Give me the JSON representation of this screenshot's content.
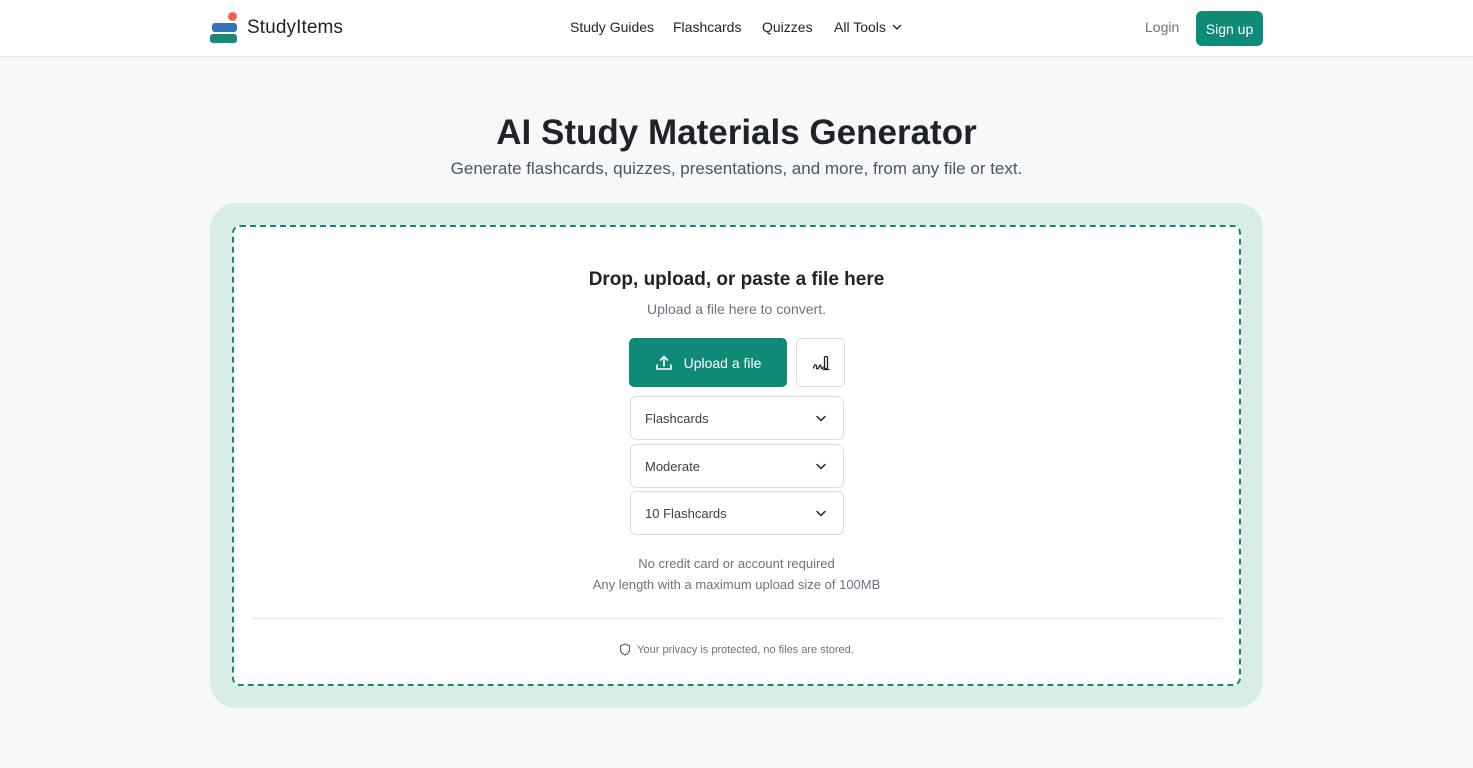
{
  "header": {
    "brand": "StudyItems",
    "nav": {
      "study_guides": "Study Guides",
      "flashcards": "Flashcards",
      "quizzes": "Quizzes",
      "all_tools": "All Tools"
    },
    "login": "Login",
    "signup": "Sign up"
  },
  "hero": {
    "title": "AI Study Materials Generator",
    "subtitle": "Generate flashcards, quizzes, presentations, and more, from any file or text."
  },
  "upload": {
    "title": "Drop, upload, or paste a file here",
    "subtitle": "Upload a file here to convert.",
    "upload_button": "Upload a file",
    "write_icon": "handwriting-icon",
    "type_select": "Flashcards",
    "difficulty_select": "Moderate",
    "count_select": "10 Flashcards",
    "note_account": "No credit card or account required",
    "note_size": "Any length with a maximum upload size of 100MB",
    "privacy": "Your privacy is protected, no files are stored."
  },
  "colors": {
    "accent": "#0f8a77",
    "card_bg": "#d8ede8",
    "page_bg": "#f7f8fa",
    "logo_dot": "#e8644a",
    "logo_blue": "#2f74b5"
  }
}
